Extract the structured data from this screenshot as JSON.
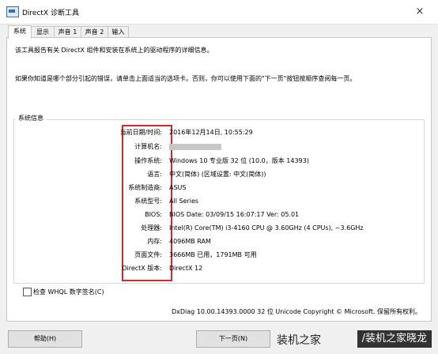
{
  "window": {
    "title": "DirectX 诊断工具",
    "close_glyph": "×",
    "icon_name": "directx-app-icon"
  },
  "tabs": [
    {
      "label": "系统",
      "active": true
    },
    {
      "label": "显示",
      "active": false
    },
    {
      "label": "声音 1",
      "active": false
    },
    {
      "label": "声音 2",
      "active": false
    },
    {
      "label": "输入",
      "active": false
    }
  ],
  "intro": {
    "line1": "该工具报告有关 DirectX 组件和安装在系统上的驱动程序的详细信息。",
    "line2": "如果你知道是哪个部分引起的错误，请单击上面适当的选项卡。否则，你可以使用下面的\"下一页\"按钮按顺序查阅每一页。"
  },
  "system_info": {
    "group_title": "系统信息",
    "rows": [
      {
        "label": "当前日期/时间:",
        "value": "2016年12月14日, 10:55:29"
      },
      {
        "label": "计算机名:",
        "value": "",
        "redacted": true
      },
      {
        "label": "操作系统:",
        "value": "Windows 10 专业版 32 位 (10.0，版本 14393)"
      },
      {
        "label": "语言:",
        "value": "中文(简体) (区域设置: 中文(简体))"
      },
      {
        "label": "系统制造商:",
        "value": "ASUS"
      },
      {
        "label": "系统型号:",
        "value": "All Series"
      },
      {
        "label": "BIOS:",
        "value": "BIOS Date: 03/09/15 16:07:17 Ver: 05.01"
      },
      {
        "label": "处理器:",
        "value": "Intel(R) Core(TM) i3-4160 CPU @ 3.60GHz (4 CPUs), ~3.6GHz"
      },
      {
        "label": "内存:",
        "value": "4096MB RAM"
      },
      {
        "label": "页面文件:",
        "value": "3666MB 已用，1791MB 可用"
      },
      {
        "label": "DirectX 版本:",
        "value": "DirectX 12"
      }
    ]
  },
  "whql": {
    "label": "检查 WHQL 数字签名(C)",
    "checked": false
  },
  "footer": "DxDiag 10.00.14393.0000 32 位 Unicode  Copyright © Microsoft. 保留所有权利。",
  "buttons": {
    "help": "帮助(H)",
    "next": "下一页(N)"
  },
  "watermark": {
    "left": "装机之家",
    "right": "/装机之家晓龙"
  },
  "colors": {
    "highlight_box": "#d9282d",
    "accent": "#3b6ea8"
  }
}
